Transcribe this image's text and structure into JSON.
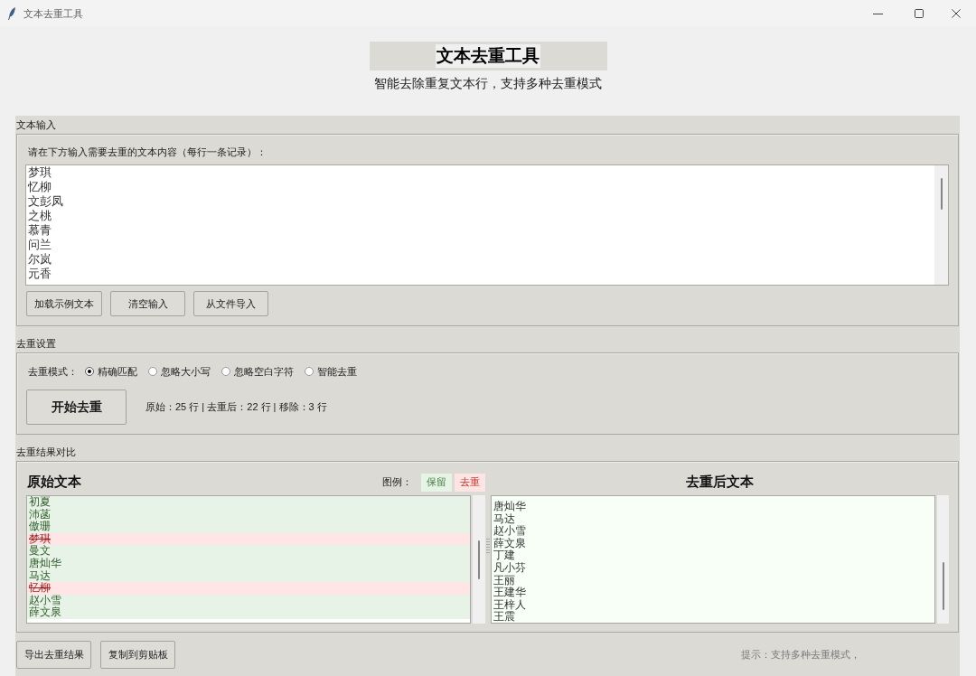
{
  "window": {
    "title": "文本去重工具"
  },
  "header": {
    "title": "文本去重工具",
    "subtitle": "智能去除重复文本行，支持多种去重模式"
  },
  "input_section": {
    "label": "文本输入",
    "prompt": "请在下方输入需要去重的文本内容（每行一条记录）：",
    "lines": [
      "梦琪",
      "忆柳",
      "文彭凤",
      "之桃",
      "慕青",
      "问兰",
      "尔岚",
      "元香"
    ],
    "buttons": [
      "加载示例文本",
      "清空输入",
      "从文件导入"
    ]
  },
  "settings_section": {
    "label": "去重设置",
    "mode_label": "去重模式：",
    "modes": [
      {
        "label": "精确匹配",
        "selected": true
      },
      {
        "label": "忽略大小写",
        "selected": false
      },
      {
        "label": "忽略空白字符",
        "selected": false
      },
      {
        "label": "智能去重",
        "selected": false
      }
    ],
    "start_button": "开始去重",
    "stats": "原始：25 行 | 去重后：22 行 | 移除：3 行"
  },
  "results_section": {
    "label": "去重结果对比",
    "original_title": "原始文本",
    "legend_label": "图例：",
    "legend": [
      {
        "label": "保留",
        "kind": "kept"
      },
      {
        "label": "去重",
        "kind": "removed"
      }
    ],
    "original_lines": [
      {
        "text": "初夏",
        "removed": false
      },
      {
        "text": "沛菡",
        "removed": false
      },
      {
        "text": "傲珊",
        "removed": false
      },
      {
        "text": "梦琪",
        "removed": true
      },
      {
        "text": "曼文",
        "removed": false
      },
      {
        "text": "唐灿华",
        "removed": false
      },
      {
        "text": "马达",
        "removed": false
      },
      {
        "text": "忆柳",
        "removed": true
      },
      {
        "text": "赵小雪",
        "removed": false
      },
      {
        "text": "薛文泉",
        "removed": false
      }
    ],
    "deduped_title": "去重后文本",
    "deduped_lines": [
      "唐灿华",
      "马达",
      "赵小雪",
      "薛文泉",
      "丁建",
      "凡小芬",
      "王丽",
      "王建华",
      "王梓人",
      "王震"
    ]
  },
  "footer": {
    "buttons": [
      "导出去重结果",
      "复制到剪贴板"
    ],
    "hint": "提示：支持多种去重模式，"
  }
}
